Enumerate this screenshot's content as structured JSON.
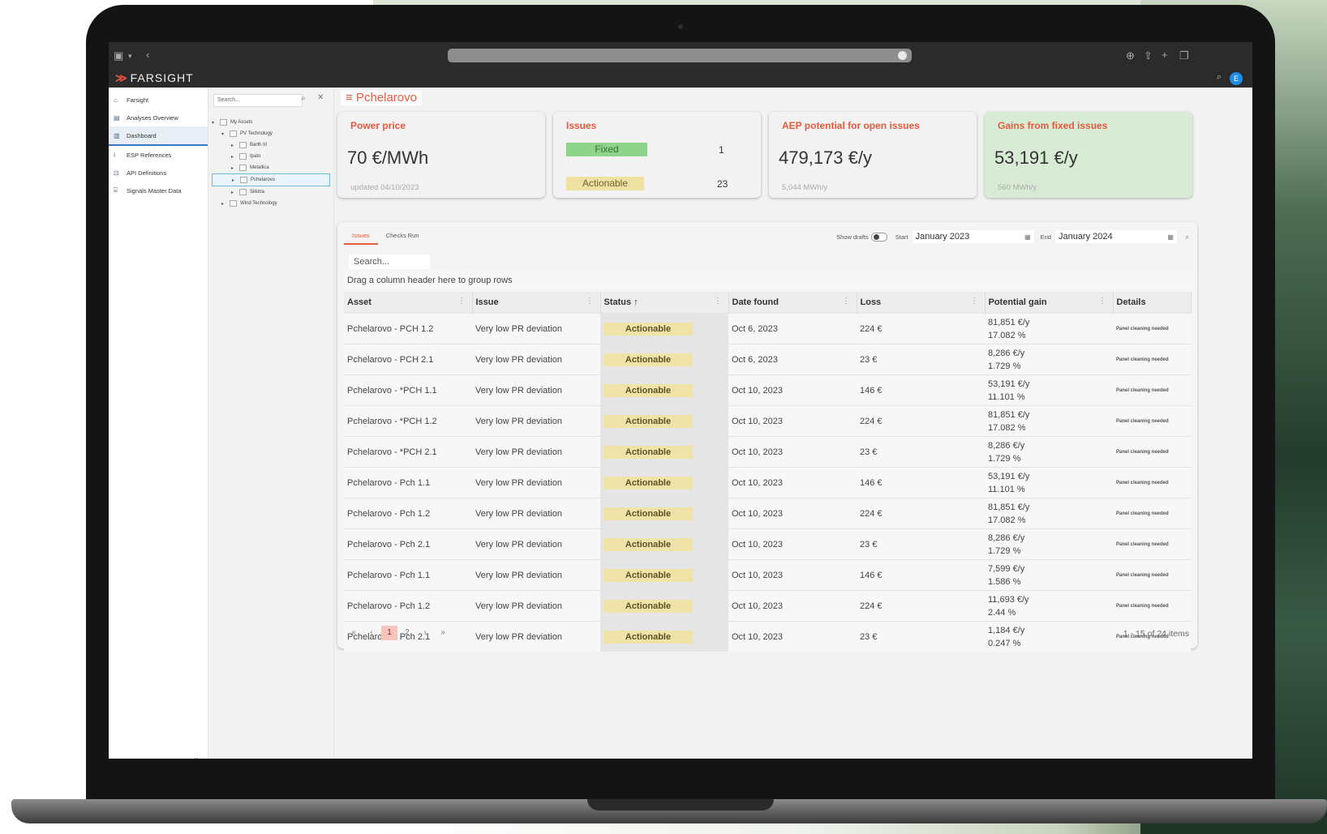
{
  "app": {
    "brand": "FARSIGHT",
    "user_initial": "E"
  },
  "nav": {
    "items": [
      {
        "label": "Farsight",
        "icon": "home-icon"
      },
      {
        "label": "Analyses Overview",
        "icon": "document-icon"
      },
      {
        "label": "Dashboard",
        "icon": "chart-icon"
      },
      {
        "label": "ESP References",
        "icon": "info-icon"
      },
      {
        "label": "API Definitions",
        "icon": "api-icon"
      },
      {
        "label": "Signals Master Data",
        "icon": "signals-icon"
      }
    ],
    "collapse_glyph": "«"
  },
  "tree": {
    "search_placeholder": "Search...",
    "nodes": [
      {
        "label": "My Assets",
        "arrow": "▾",
        "indent": 0
      },
      {
        "label": "PV Technology",
        "arrow": "▾",
        "indent": 1
      },
      {
        "label": "Barth III",
        "arrow": "▸",
        "indent": 2
      },
      {
        "label": "Ipato",
        "arrow": "▸",
        "indent": 2
      },
      {
        "label": "Metallica",
        "arrow": "▸",
        "indent": 2
      },
      {
        "label": "Pchelarovo",
        "arrow": "▸",
        "indent": 2,
        "selected": true
      },
      {
        "label": "Silistra",
        "arrow": "▸",
        "indent": 2
      },
      {
        "label": "Wind Technology",
        "arrow": "▸",
        "indent": 1
      }
    ]
  },
  "page": {
    "title": "Pchelarovo",
    "title_prefix": "≡"
  },
  "cards": {
    "power": {
      "title": "Power price",
      "value": "70 €/MWh",
      "sub": "updated 04/10/2023"
    },
    "issues": {
      "title": "Issues",
      "fixed_label": "Fixed",
      "fixed_count": "1",
      "actionable_label": "Actionable",
      "actionable_count": "23"
    },
    "aep": {
      "title": "AEP potential for open issues",
      "value": "479,173 €/y",
      "sub": "5,044 MWh/y"
    },
    "gains": {
      "title": "Gains from fixed issues",
      "value": "53,191 €/y",
      "sub": "560 MWh/y"
    }
  },
  "panel": {
    "tabs": [
      "Issues",
      "Checks Run"
    ],
    "show_drafts_label": "Show drafts",
    "start_label": "Start",
    "start_value": "January 2023",
    "end_label": "End",
    "end_value": "January 2024",
    "search_placeholder": "Search...",
    "group_hint": "Drag a column header here to group rows"
  },
  "table": {
    "columns": [
      "Asset",
      "Issue",
      "Status ↑",
      "Date found",
      "Loss",
      "Potential gain",
      "Details"
    ],
    "rows": [
      {
        "asset": "Pchelarovo - PCH 1.2",
        "issue": "Very low PR deviation",
        "status": "Actionable",
        "date": "Oct 6, 2023",
        "loss": "224 €",
        "gain": "81,851 €/y",
        "gain_pct": "17.082 %",
        "details": "Panel cleaning needed"
      },
      {
        "asset": "Pchelarovo - PCH 2.1",
        "issue": "Very low PR deviation",
        "status": "Actionable",
        "date": "Oct 6, 2023",
        "loss": "23 €",
        "gain": "8,286 €/y",
        "gain_pct": "1.729 %",
        "details": "Panel cleaning needed"
      },
      {
        "asset": "Pchelarovo - *PCH 1.1",
        "issue": "Very low PR deviation",
        "status": "Actionable",
        "date": "Oct 10, 2023",
        "loss": "146 €",
        "gain": "53,191 €/y",
        "gain_pct": "11.101 %",
        "details": "Panel cleaning needed"
      },
      {
        "asset": "Pchelarovo - *PCH 1.2",
        "issue": "Very low PR deviation",
        "status": "Actionable",
        "date": "Oct 10, 2023",
        "loss": "224 €",
        "gain": "81,851 €/y",
        "gain_pct": "17.082 %",
        "details": "Panel cleaning needed"
      },
      {
        "asset": "Pchelarovo - *PCH 2.1",
        "issue": "Very low PR deviation",
        "status": "Actionable",
        "date": "Oct 10, 2023",
        "loss": "23 €",
        "gain": "8,286 €/y",
        "gain_pct": "1.729 %",
        "details": "Panel cleaning needed"
      },
      {
        "asset": "Pchelarovo - Pch 1.1",
        "issue": "Very low PR deviation",
        "status": "Actionable",
        "date": "Oct 10, 2023",
        "loss": "146 €",
        "gain": "53,191 €/y",
        "gain_pct": "11.101 %",
        "details": "Panel cleaning needed"
      },
      {
        "asset": "Pchelarovo - Pch 1.2",
        "issue": "Very low PR deviation",
        "status": "Actionable",
        "date": "Oct 10, 2023",
        "loss": "224 €",
        "gain": "81,851 €/y",
        "gain_pct": "17.082 %",
        "details": "Panel cleaning needed"
      },
      {
        "asset": "Pchelarovo - Pch 2.1",
        "issue": "Very low PR deviation",
        "status": "Actionable",
        "date": "Oct 10, 2023",
        "loss": "23 €",
        "gain": "8,286 €/y",
        "gain_pct": "1.729 %",
        "details": "Panel cleaning needed"
      },
      {
        "asset": "Pchelarovo - Pch 1.1",
        "issue": "Very low PR deviation",
        "status": "Actionable",
        "date": "Oct 10, 2023",
        "loss": "146 €",
        "gain": "7,599 €/y",
        "gain_pct": "1.586 %",
        "details": "Panel cleaning needed"
      },
      {
        "asset": "Pchelarovo - Pch 1.2",
        "issue": "Very low PR deviation",
        "status": "Actionable",
        "date": "Oct 10, 2023",
        "loss": "224 €",
        "gain": "11,693 €/y",
        "gain_pct": "2.44 %",
        "details": "Panel cleaning needed"
      },
      {
        "asset": "Pchelarovo - Pch 2.1",
        "issue": "Very low PR deviation",
        "status": "Actionable",
        "date": "Oct 10, 2023",
        "loss": "23 €",
        "gain": "1,184 €/y",
        "gain_pct": "0.247 %",
        "details": "Panel cleaning needed"
      }
    ]
  },
  "pager": {
    "first": "«",
    "prev": "‹",
    "pages": [
      "1",
      "2"
    ],
    "current": "1",
    "next": "›",
    "last": "»",
    "info": "1 - 15 of 24 items"
  }
}
